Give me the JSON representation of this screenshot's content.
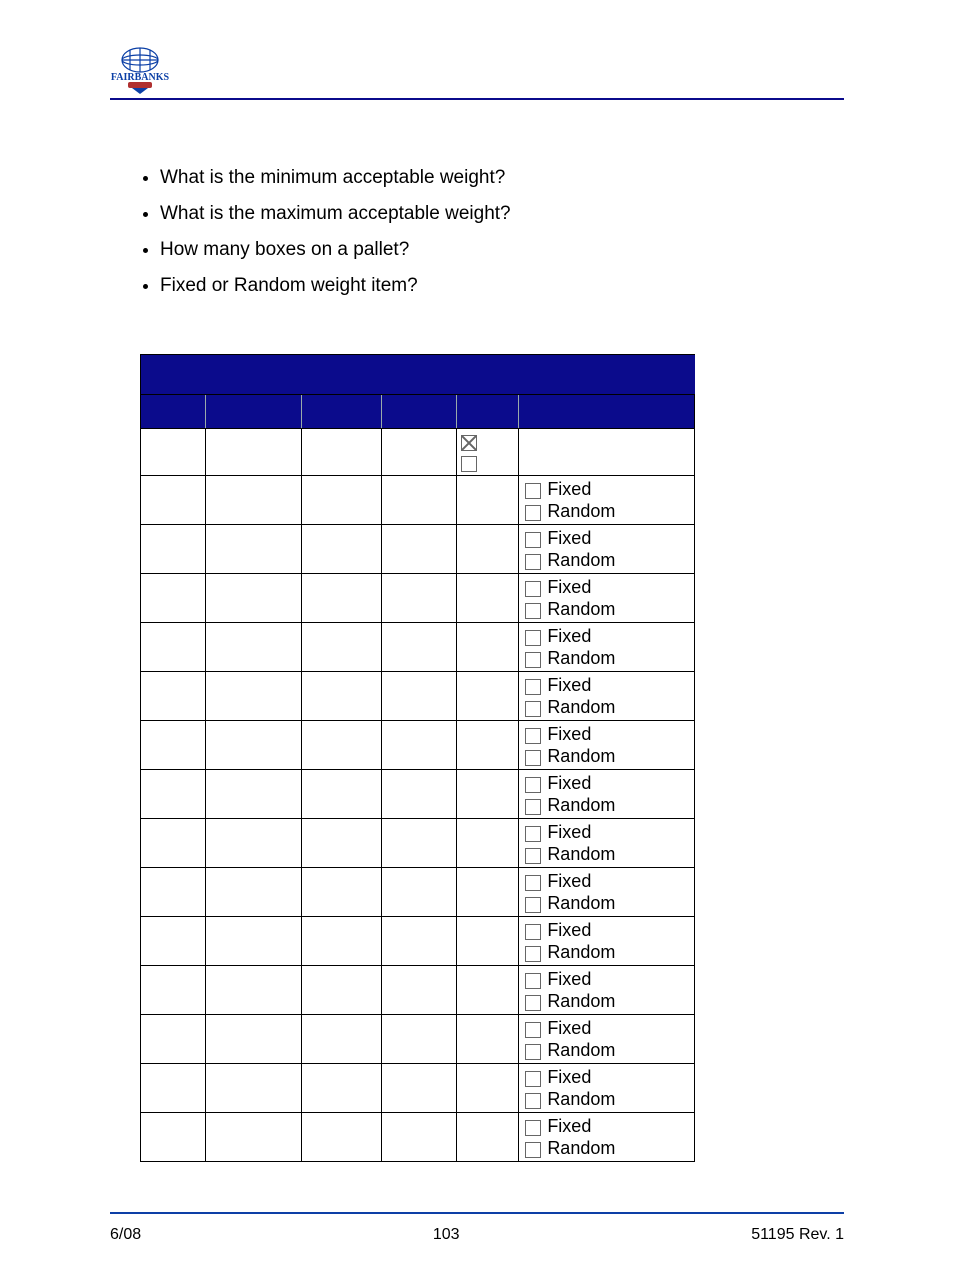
{
  "bullets": [
    "What is the minimum acceptable weight?",
    "What is the maximum acceptable weight?",
    "How many boxes on a pallet?",
    "Fixed or Random weight item?"
  ],
  "option_labels": {
    "fixed": "Fixed",
    "random": "Random"
  },
  "first_row_checked": true,
  "row_count": 14,
  "footer": {
    "left": "6/08",
    "center": "103",
    "right": "51195   Rev. 1"
  }
}
